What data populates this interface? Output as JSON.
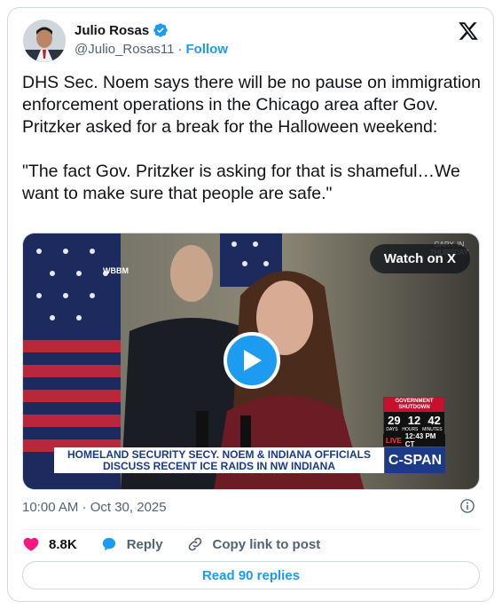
{
  "author": {
    "name": "Julio Rosas",
    "handle": "@Julio_Rosas11",
    "separator": "·",
    "follow_label": "Follow",
    "verified_icon": "verified-badge-icon"
  },
  "tweet": {
    "text": "DHS Sec. Noem says there will be no pause on immigration enforcement operations in the Chicago area after Gov. Pritzker asked for a break for the Halloween weekend:\n\n\"The fact Gov. Pritzker is asking for that is shameful…We want to make sure that people are safe.\""
  },
  "media": {
    "watch_label": "Watch on X",
    "station_bug": "WBBM",
    "location_bug": "GARY, IN\nTHURSDAY",
    "shutdown_header": "GOVERNMENT\nSHUTDOWN",
    "shutdown_days": "29",
    "shutdown_hours": "12",
    "shutdown_minutes": "42",
    "unit_days": "DAYS",
    "unit_hours": "HOURS",
    "unit_minutes": "MINUTES",
    "live_label": "LIVE",
    "live_time": "12:43 PM CT",
    "chyron_line1": "HOMELAND SECURITY SECY. NOEM & INDIANA OFFICIALS",
    "chyron_line2": "DISCUSS RECENT ICE RAIDS IN NW INDIANA",
    "network": "C-SPAN"
  },
  "meta": {
    "timestamp": "10:00 AM · Oct 30, 2025"
  },
  "actions": {
    "likes": "8.8K",
    "reply_label": "Reply",
    "copy_label": "Copy link to post"
  },
  "read_replies_label": "Read 90 replies",
  "colors": {
    "accent": "#1d9bf0",
    "like": "#f91880",
    "text": "#0f1419",
    "muted": "#536471",
    "border": "#cfd9de"
  }
}
